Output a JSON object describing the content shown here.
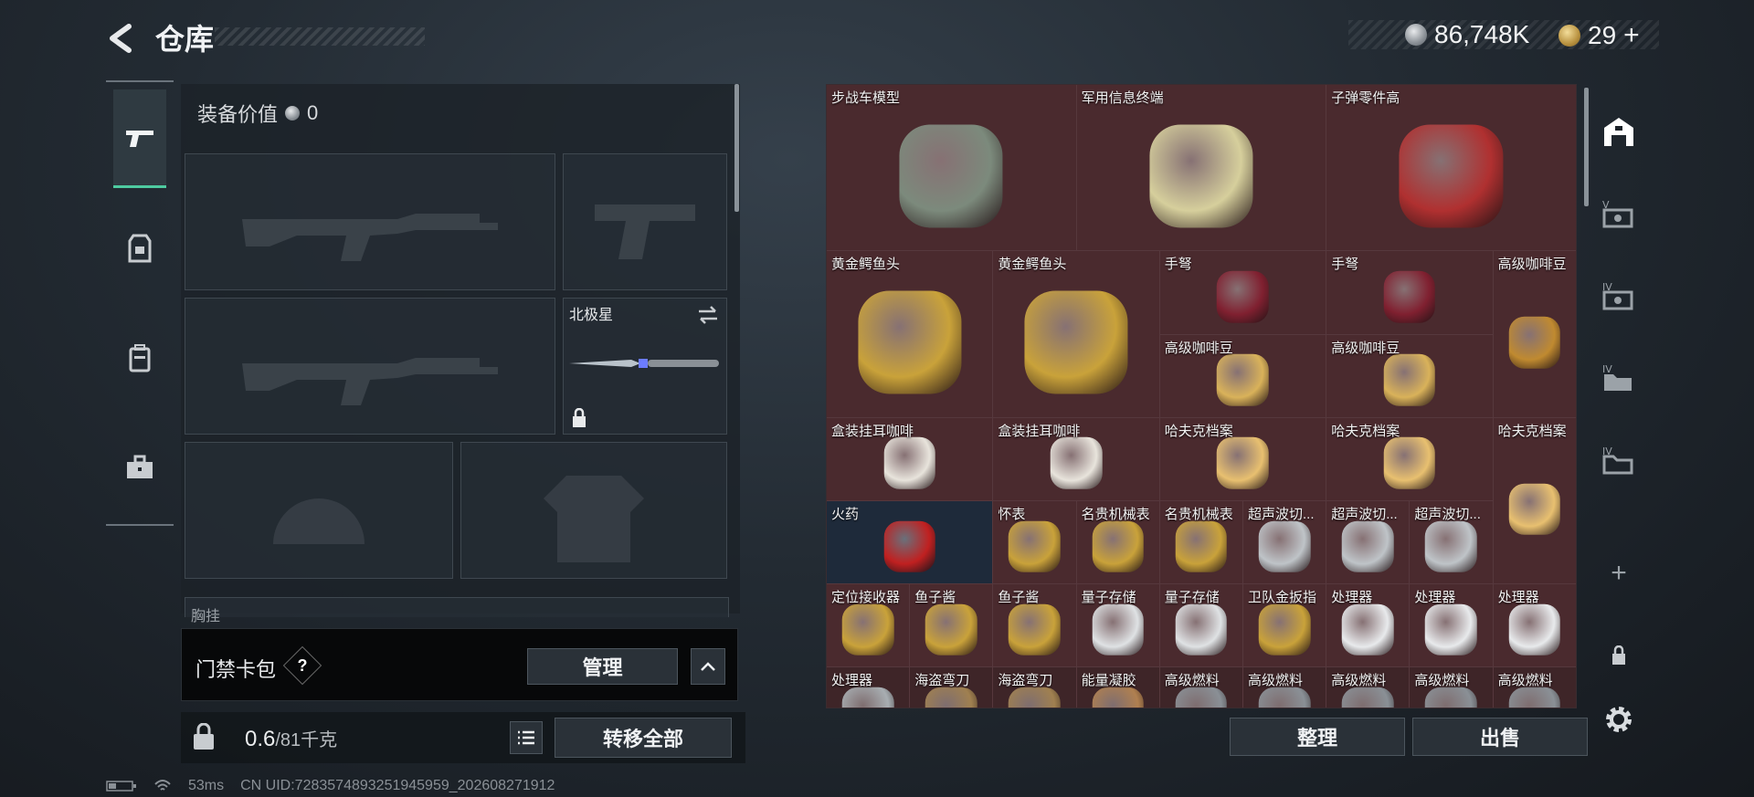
{
  "header": {
    "title": "仓库"
  },
  "currency": {
    "silver": "86,748K",
    "gold": "29"
  },
  "equipment": {
    "value_label": "装备价值",
    "value": "0",
    "melee_name": "北极星",
    "chest_label": "胸挂"
  },
  "cardbag": {
    "label": "门禁卡包",
    "help": "?",
    "manage": "管理"
  },
  "footer": {
    "weight": "0.6",
    "weight_max": "/81千克",
    "transfer_all": "转移全部",
    "sort": "整理",
    "sell": "出售"
  },
  "status": {
    "ping": "53ms",
    "uid": "CN UID:7283574893251945959_202608271912"
  },
  "items": [
    {
      "name": "步战车模型"
    },
    {
      "name": "军用信息终端"
    },
    {
      "name": "子弹零件高"
    },
    {
      "name": "黄金鳄鱼头"
    },
    {
      "name": "黄金鳄鱼头"
    },
    {
      "name": "手弩"
    },
    {
      "name": "手弩"
    },
    {
      "name": "高级咖啡豆"
    },
    {
      "name": "高级咖啡豆"
    },
    {
      "name": "高级咖啡豆"
    },
    {
      "name": "盒装挂耳咖啡"
    },
    {
      "name": "盒装挂耳咖啡"
    },
    {
      "name": "哈夫克档案"
    },
    {
      "name": "哈夫克档案"
    },
    {
      "name": "哈夫克档案"
    },
    {
      "name": "火药"
    },
    {
      "name": "怀表"
    },
    {
      "name": "名贵机械表"
    },
    {
      "name": "名贵机械表"
    },
    {
      "name": "超声波切..."
    },
    {
      "name": "超声波切..."
    },
    {
      "name": "超声波切..."
    },
    {
      "name": "定位接收器"
    },
    {
      "name": "鱼子酱"
    },
    {
      "name": "鱼子酱"
    },
    {
      "name": "量子存储"
    },
    {
      "name": "量子存储"
    },
    {
      "name": "卫队金扳指"
    },
    {
      "name": "处理器"
    },
    {
      "name": "处理器"
    },
    {
      "name": "处理器"
    },
    {
      "name": "处理器"
    },
    {
      "name": "海盗弯刀"
    },
    {
      "name": "海盗弯刀"
    },
    {
      "name": "能量凝胶"
    },
    {
      "name": "高级燃料"
    },
    {
      "name": "高级燃料"
    },
    {
      "name": "高级燃料"
    },
    {
      "name": "高级燃料"
    },
    {
      "name": "高级燃料"
    }
  ],
  "colors": {
    "accent": "#4ecba0",
    "item_bg": "#4a2a2e",
    "blue_bg": "#1e2a3a"
  },
  "icons": {
    "back": "back-arrow-icon",
    "pistol": "pistol-icon",
    "vest": "vest-icon",
    "backpack": "backpack-icon",
    "case": "case-icon",
    "lock": "lock-icon",
    "gear": "gear-icon"
  }
}
